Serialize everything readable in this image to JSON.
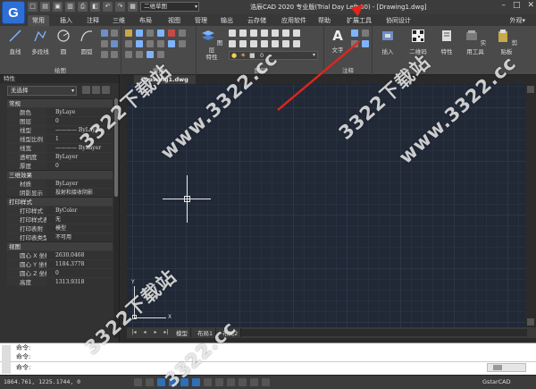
{
  "app": {
    "logo": "G",
    "title": "浩辰CAD 2020 专业版(Trial Day Left 30) - [Drawing1.dwg]",
    "workspace": "二维草图"
  },
  "tabs": [
    "常用",
    "插入",
    "注释",
    "三维",
    "布局",
    "视图",
    "管理",
    "输出",
    "云存储",
    "应用软件",
    "帮助",
    "扩展工具",
    "协同设计"
  ],
  "tabs_right": "外观▾",
  "ribbon": {
    "draw": {
      "label": "绘图",
      "buttons": [
        "直线",
        "多段线",
        "圆",
        "圆弧"
      ]
    },
    "modify": {
      "label": "修改"
    },
    "layers": {
      "label": "图层",
      "big": "图层\n特性"
    },
    "annotate": {
      "label": "注释",
      "big": "文字"
    },
    "right": [
      "插入",
      "二维码",
      "特性",
      "实用工具",
      "剪贴板"
    ]
  },
  "palette": {
    "title": "特性",
    "selection": "无选择",
    "sections": [
      {
        "name": "常规",
        "rows": [
          [
            "颜色",
            "ByLaye"
          ],
          [
            "图层",
            "0"
          ],
          [
            "线型",
            "———— ByLayer"
          ],
          [
            "线型比例",
            "1"
          ],
          [
            "线宽",
            "———— ByLayer"
          ],
          [
            "透明度",
            "ByLayer"
          ],
          [
            "厚度",
            "0"
          ]
        ]
      },
      {
        "name": "三维效果",
        "rows": [
          [
            "材质",
            "ByLayer"
          ],
          [
            "阴影显示",
            "投射和接收阴影"
          ]
        ]
      },
      {
        "name": "打印样式",
        "rows": [
          [
            "打印样式",
            "ByColor"
          ],
          [
            "打印样式表",
            "无"
          ],
          [
            "打印表附",
            "模型"
          ],
          [
            "打印表类型",
            "不可用"
          ]
        ]
      },
      {
        "name": "视图",
        "rows": [
          [
            "圆心 X 坐标",
            "2630.0468"
          ],
          [
            "圆心 Y 坐标",
            "1184.3778"
          ],
          [
            "圆心 Z 坐标",
            "0"
          ],
          [
            "高度",
            "1313.9318"
          ]
        ]
      }
    ]
  },
  "document": {
    "tab": "Drawing1.dwg"
  },
  "layouts": [
    "模型",
    "布局1",
    "布局2",
    "+"
  ],
  "ucs": {
    "x": "X",
    "y": "Y"
  },
  "command": {
    "lines": [
      "命令:",
      "命令:"
    ],
    "prompt": "命令:"
  },
  "status": {
    "coords": "1864.761, 1225.1744, 0",
    "brand": "GstarCAD"
  },
  "watermark": [
    "3322下载站",
    "www.3322.cc",
    "3322下载站",
    "www.3322.cc",
    "3322下载站",
    "3322.cc"
  ],
  "colors": {
    "accent": "#2f6fb8",
    "arrow": "#e2261d",
    "canvas": "#212836"
  }
}
